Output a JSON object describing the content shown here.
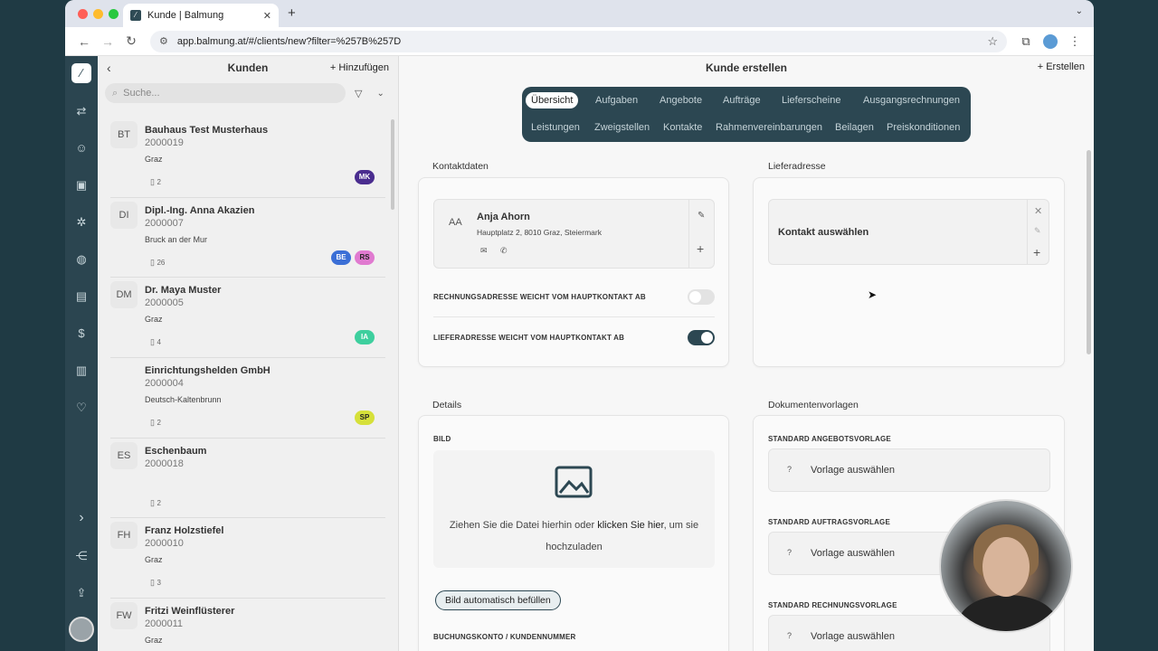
{
  "browser": {
    "tab_title": "Kunde | Balmung",
    "url": "app.balmung.at/#/clients/new?filter=%257B%257D",
    "traffic_colors": [
      "#ff5f57",
      "#febc2e",
      "#28c840"
    ]
  },
  "list_panel": {
    "title": "Kunden",
    "add_label": "Hinzufügen",
    "search_placeholder": "Suche...",
    "clients": [
      {
        "initials": "BT",
        "name": "Bauhaus Test Musterhaus",
        "number": "2000019",
        "city": "Graz",
        "docs": "2",
        "badges": [
          {
            "text": "MK",
            "color": "#4a2d8f",
            "fg": "#ffffff"
          }
        ]
      },
      {
        "initials": "DI",
        "name": "Dipl.-Ing. Anna Akazien",
        "number": "2000007",
        "city": "Bruck an der Mur",
        "docs": "26",
        "badges": [
          {
            "text": "BE",
            "color": "#3b6fd6",
            "fg": "#ffffff"
          },
          {
            "text": "RS",
            "color": "#e07ad0",
            "fg": "#222222"
          }
        ]
      },
      {
        "initials": "DM",
        "name": "Dr. Maya Muster",
        "number": "2000005",
        "city": "Graz",
        "docs": "4",
        "badges": [
          {
            "text": "IA",
            "color": "#3ecf9e",
            "fg": "#ffffff"
          }
        ]
      },
      {
        "initials": "",
        "name": "Einrichtungshelden GmbH",
        "number": "2000004",
        "city": "Deutsch-Kaltenbrunn",
        "docs": "2",
        "badges": [
          {
            "text": "SP",
            "color": "#d6e03a",
            "fg": "#222222"
          }
        ]
      },
      {
        "initials": "ES",
        "name": "Eschenbaum",
        "number": "2000018",
        "city": "",
        "docs": "2",
        "badges": []
      },
      {
        "initials": "FH",
        "name": "Franz Holzstiefel",
        "number": "2000010",
        "city": "Graz",
        "docs": "3",
        "badges": []
      },
      {
        "initials": "FW",
        "name": "Fritzi Weinflüsterer",
        "number": "2000011",
        "city": "Graz",
        "docs": "",
        "badges": []
      }
    ]
  },
  "main": {
    "title": "Kunde erstellen",
    "create_label": "Erstellen",
    "tabs_row1": [
      "Übersicht",
      "Aufgaben",
      "Angebote",
      "Aufträge",
      "Lieferscheine",
      "Ausgangsrechnungen"
    ],
    "tabs_row2": [
      "Leistungen",
      "Zweigstellen",
      "Kontakte",
      "Rahmenvereinbarungen",
      "Beilagen",
      "Preiskonditionen"
    ],
    "kontaktdaten": {
      "title": "Kontaktdaten",
      "contact_initials": "AA",
      "contact_name": "Anja Ahorn",
      "contact_address": "Hauptplatz 2, 8010 Graz, Steiermark",
      "toggle1_label": "RECHNUNGSADRESSE WEICHT VOM HAUPTKONTAKT AB",
      "toggle1_on": false,
      "toggle2_label": "LIEFERADRESSE WEICHT VOM HAUPTKONTAKT AB",
      "toggle2_on": true
    },
    "lieferadresse": {
      "title": "Lieferadresse",
      "select_label": "Kontakt auswählen"
    },
    "details": {
      "title": "Details",
      "bild_label": "BILD",
      "upload_text_a": "Ziehen Sie die Datei hierhin oder ",
      "upload_link": "klicken Sie hier",
      "upload_text_b": ", um sie",
      "upload_text_c": "hochzuladen",
      "auto_fill": "Bild automatisch befüllen",
      "account_label": "BUCHUNGSKONTO / KUNDENNUMMER"
    },
    "dokumentenvorlagen": {
      "title": "Dokumentenvorlagen",
      "items": [
        {
          "label": "STANDARD ANGEBOTSVORLAGE",
          "value": "Vorlage auswählen"
        },
        {
          "label": "STANDARD AUFTRAGSVORLAGE",
          "value": "Vorlage auswählen"
        },
        {
          "label": "STANDARD RECHNUNGSVORLAGE",
          "value": "Vorlage auswählen"
        }
      ]
    },
    "accent_color": "#2c4752"
  }
}
